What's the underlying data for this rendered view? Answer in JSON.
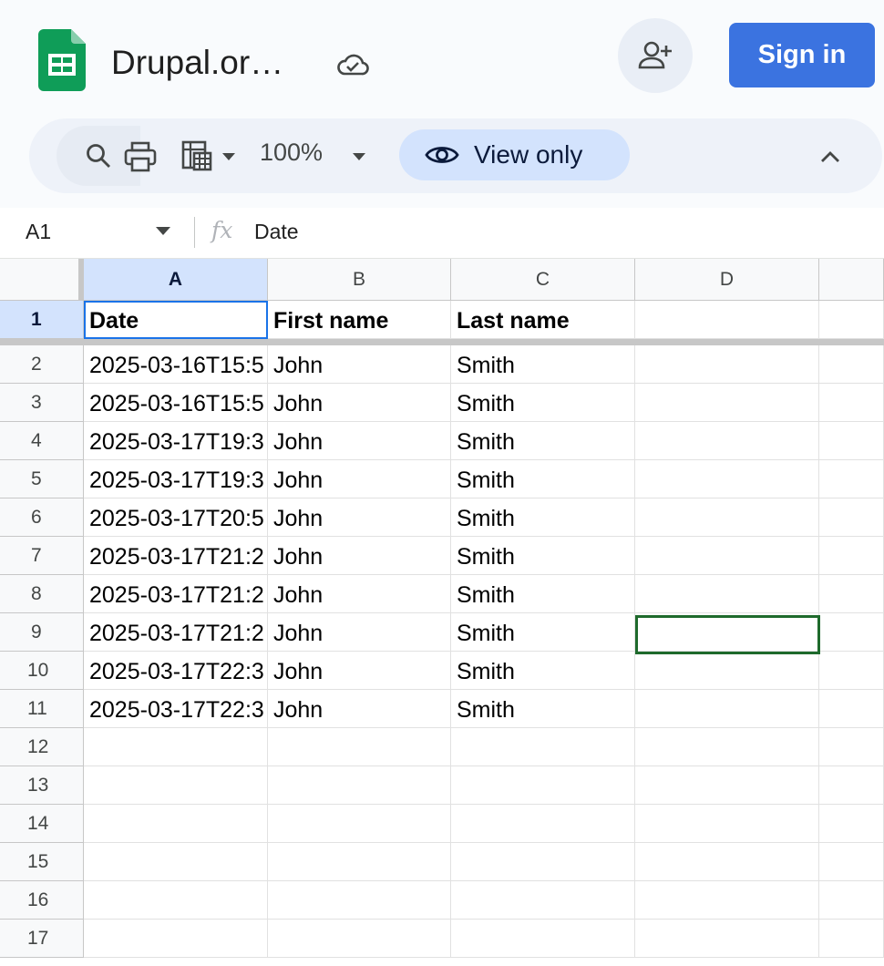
{
  "header": {
    "doc_title": "Drupal.or…",
    "sign_in_label": "Sign in"
  },
  "toolbar": {
    "zoom": "100%",
    "view_only_label": "View only"
  },
  "formula_bar": {
    "cell_ref": "A1",
    "fx_symbol": "fx",
    "value": "Date"
  },
  "sheet": {
    "columns": [
      "A",
      "B",
      "C",
      "D"
    ],
    "row_numbers": [
      "1",
      "2",
      "3",
      "4",
      "5",
      "6",
      "7",
      "8",
      "9",
      "10",
      "11",
      "12",
      "13",
      "14",
      "15",
      "16",
      "17"
    ],
    "header_row": [
      "Date",
      "First name",
      "Last name",
      ""
    ],
    "rows": [
      [
        "2025-03-16T15:5",
        "John",
        "Smith",
        ""
      ],
      [
        "2025-03-16T15:5",
        "John",
        "Smith",
        ""
      ],
      [
        "2025-03-17T19:3",
        "John",
        "Smith",
        ""
      ],
      [
        "2025-03-17T19:3",
        "John",
        "Smith",
        ""
      ],
      [
        "2025-03-17T20:5",
        "John",
        "Smith",
        ""
      ],
      [
        "2025-03-17T21:2",
        "John",
        "Smith",
        ""
      ],
      [
        "2025-03-17T21:2",
        "John",
        "Smith",
        ""
      ],
      [
        "2025-03-17T21:2",
        "John",
        "Smith",
        ""
      ],
      [
        "2025-03-17T22:3",
        "John",
        "Smith",
        ""
      ],
      [
        "2025-03-17T22:3",
        "John",
        "Smith",
        ""
      ],
      [
        "",
        "",
        "",
        ""
      ],
      [
        "",
        "",
        "",
        ""
      ],
      [
        "",
        "",
        "",
        ""
      ],
      [
        "",
        "",
        "",
        ""
      ],
      [
        "",
        "",
        "",
        ""
      ],
      [
        "",
        "",
        "",
        ""
      ]
    ],
    "selected_column": "A",
    "selected_row": "1",
    "highlighted_cell": "D9"
  },
  "colors": {
    "brand_green": "#0f9d58",
    "sign_in_blue": "#3b73e0",
    "view_only_bg": "#d3e3fd",
    "selection_blue": "#1a73e8",
    "active_cell_green": "#1e6a2c"
  },
  "icons": {
    "logo": "google-sheets-logo",
    "cloud": "cloud-check-icon",
    "share": "person-add-icon",
    "search": "search-icon",
    "print": "print-icon",
    "format": "table-format-icon",
    "view": "eye-icon",
    "collapse": "chevron-up-icon"
  }
}
